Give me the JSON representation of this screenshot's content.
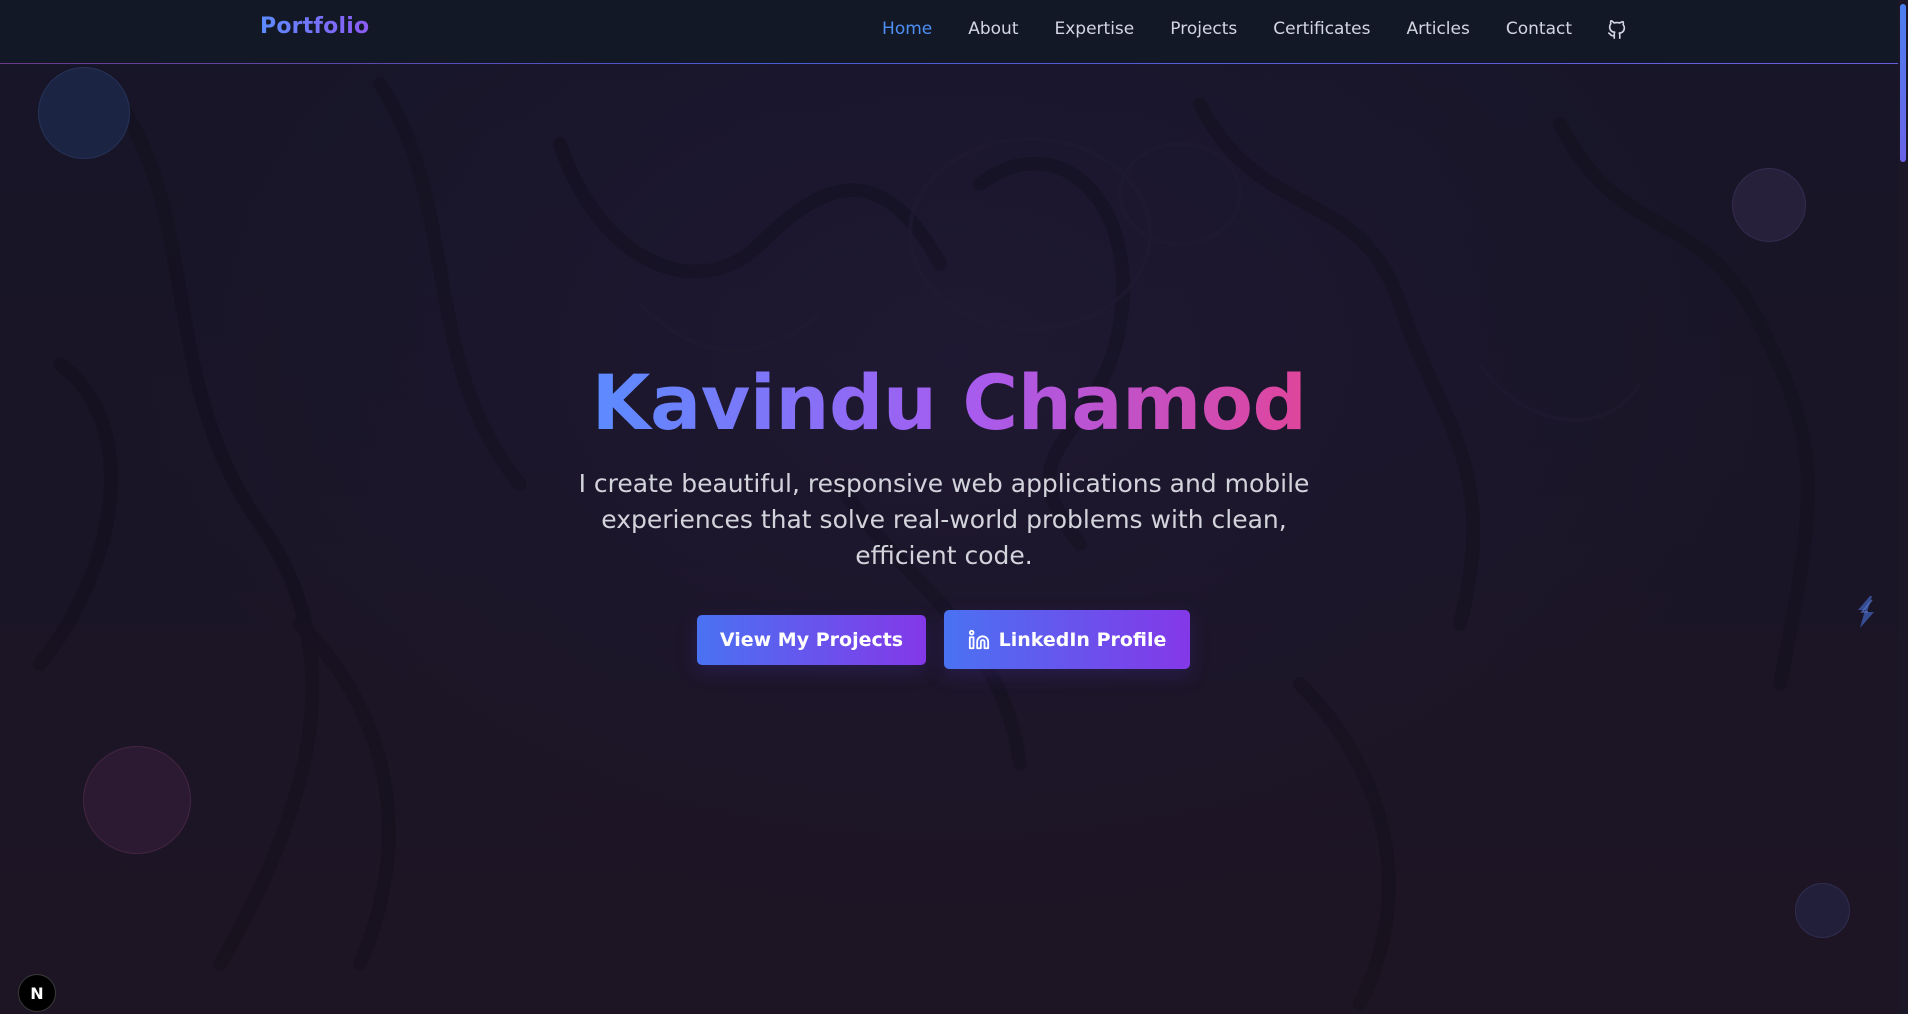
{
  "header": {
    "brand": "Portfolio",
    "nav": [
      {
        "label": "Home",
        "active": true
      },
      {
        "label": "About",
        "active": false
      },
      {
        "label": "Expertise",
        "active": false
      },
      {
        "label": "Projects",
        "active": false
      },
      {
        "label": "Certificates",
        "active": false
      },
      {
        "label": "Articles",
        "active": false
      },
      {
        "label": "Contact",
        "active": false
      }
    ],
    "github_icon": "github-icon"
  },
  "hero": {
    "name": "Kavindu Chamod",
    "subtitle": "I create beautiful, responsive web applications and mobile experiences that solve real-world problems with clean, efficient code.",
    "primary_button": "View My Projects",
    "secondary_button": "LinkedIn Profile",
    "secondary_icon": "linkedin-icon"
  },
  "dev_indicator": {
    "letter": "N",
    "icon": "nextjs-icon"
  },
  "side_widget": {
    "icon": "lightning-icon"
  },
  "colors": {
    "accent_blue": "#4c8ff5",
    "gradient_start": "#5b8cff",
    "gradient_mid": "#a65cf0",
    "gradient_end": "#e0459b",
    "nav_bg": "#131826",
    "page_bg": "#171528"
  }
}
